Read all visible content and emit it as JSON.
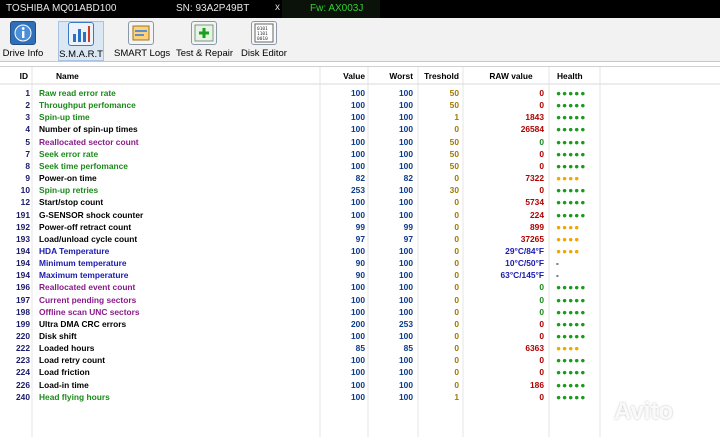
{
  "topbar": {
    "model": "TOSHIBA MQ01ABD100",
    "serial": "SN: 93A2P49BT",
    "close": "x",
    "firmware": "Fw: AX003J"
  },
  "toolbar": [
    {
      "label": "Drive Info",
      "icon": "info-icon",
      "active": false
    },
    {
      "label": "S.M.A.R.T",
      "icon": "smart-chart-icon",
      "active": true
    },
    {
      "label": "SMART Logs",
      "icon": "logs-icon",
      "active": false
    },
    {
      "label": "Test & Repair",
      "icon": "repair-icon",
      "active": false
    },
    {
      "label": "Disk Editor",
      "icon": "hex-editor-icon",
      "active": false
    }
  ],
  "columns": {
    "id": "ID",
    "name": "Name",
    "value": "Value",
    "worst": "Worst",
    "threshold": "Treshold",
    "raw": "RAW value",
    "health": "Health"
  },
  "colors": {
    "green": "#1a8a1a",
    "black": "#000000",
    "purple": "#8a1a8a",
    "blue": "#1a1ab0",
    "value_blue": "#0a3a8a",
    "raw_red": "#b00000",
    "raw_green": "#1a8a1a",
    "raw_blue": "#1a1ab0",
    "health_green": "#1a9a1a",
    "health_yellow": "#f0a800"
  },
  "rows": [
    {
      "id": "1",
      "name": "Raw read error rate",
      "color": "green",
      "value": "100",
      "worst": "100",
      "threshold": "50",
      "raw": "0",
      "raw_color": "raw_red",
      "health": "●●●●●",
      "health_color": "health_green"
    },
    {
      "id": "2",
      "name": "Throughput perfomance",
      "color": "green",
      "value": "100",
      "worst": "100",
      "threshold": "50",
      "raw": "0",
      "raw_color": "raw_red",
      "health": "●●●●●",
      "health_color": "health_green"
    },
    {
      "id": "3",
      "name": "Spin-up time",
      "color": "green",
      "value": "100",
      "worst": "100",
      "threshold": "1",
      "raw": "1843",
      "raw_color": "raw_red",
      "health": "●●●●●",
      "health_color": "health_green"
    },
    {
      "id": "4",
      "name": "Number of spin-up times",
      "color": "black",
      "value": "100",
      "worst": "100",
      "threshold": "0",
      "raw": "26584",
      "raw_color": "raw_red",
      "health": "●●●●●",
      "health_color": "health_green"
    },
    {
      "id": "5",
      "name": "Reallocated sector count",
      "color": "purple",
      "value": "100",
      "worst": "100",
      "threshold": "50",
      "raw": "0",
      "raw_color": "raw_green",
      "health": "●●●●●",
      "health_color": "health_green"
    },
    {
      "id": "7",
      "name": "Seek error rate",
      "color": "green",
      "value": "100",
      "worst": "100",
      "threshold": "50",
      "raw": "0",
      "raw_color": "raw_red",
      "health": "●●●●●",
      "health_color": "health_green"
    },
    {
      "id": "8",
      "name": "Seek time perfomance",
      "color": "green",
      "value": "100",
      "worst": "100",
      "threshold": "50",
      "raw": "0",
      "raw_color": "raw_red",
      "health": "●●●●●",
      "health_color": "health_green"
    },
    {
      "id": "9",
      "name": "Power-on time",
      "color": "black",
      "value": "82",
      "worst": "82",
      "threshold": "0",
      "raw": "7322",
      "raw_color": "raw_red",
      "health": "●●●●",
      "health_color": "health_yellow"
    },
    {
      "id": "10",
      "name": "Spin-up retries",
      "color": "green",
      "value": "253",
      "worst": "100",
      "threshold": "30",
      "raw": "0",
      "raw_color": "raw_red",
      "health": "●●●●●",
      "health_color": "health_green"
    },
    {
      "id": "12",
      "name": "Start/stop count",
      "color": "black",
      "value": "100",
      "worst": "100",
      "threshold": "0",
      "raw": "5734",
      "raw_color": "raw_red",
      "health": "●●●●●",
      "health_color": "health_green"
    },
    {
      "id": "191",
      "name": "G-SENSOR shock counter",
      "color": "black",
      "value": "100",
      "worst": "100",
      "threshold": "0",
      "raw": "224",
      "raw_color": "raw_red",
      "health": "●●●●●",
      "health_color": "health_green"
    },
    {
      "id": "192",
      "name": "Power-off retract count",
      "color": "black",
      "value": "99",
      "worst": "99",
      "threshold": "0",
      "raw": "899",
      "raw_color": "raw_red",
      "health": "●●●●",
      "health_color": "health_yellow"
    },
    {
      "id": "193",
      "name": "Load/unload cycle count",
      "color": "black",
      "value": "97",
      "worst": "97",
      "threshold": "0",
      "raw": "37265",
      "raw_color": "raw_red",
      "health": "●●●●",
      "health_color": "health_yellow"
    },
    {
      "id": "194",
      "name": "HDA Temperature",
      "color": "blue",
      "value": "100",
      "worst": "100",
      "threshold": "0",
      "raw": "29°C/84°F",
      "raw_color": "raw_blue",
      "health": "●●●●",
      "health_color": "health_yellow"
    },
    {
      "id": "194",
      "name": "Minimum temperature",
      "color": "blue",
      "value": "90",
      "worst": "100",
      "threshold": "0",
      "raw": "10°C/50°F",
      "raw_color": "raw_blue",
      "health": "-",
      "health_color": "black"
    },
    {
      "id": "194",
      "name": "Maximum temperature",
      "color": "blue",
      "value": "90",
      "worst": "100",
      "threshold": "0",
      "raw": "63°C/145°F",
      "raw_color": "raw_blue",
      "health": "-",
      "health_color": "black"
    },
    {
      "id": "196",
      "name": "Reallocated event count",
      "color": "purple",
      "value": "100",
      "worst": "100",
      "threshold": "0",
      "raw": "0",
      "raw_color": "raw_green",
      "health": "●●●●●",
      "health_color": "health_green"
    },
    {
      "id": "197",
      "name": "Current pending sectors",
      "color": "purple",
      "value": "100",
      "worst": "100",
      "threshold": "0",
      "raw": "0",
      "raw_color": "raw_green",
      "health": "●●●●●",
      "health_color": "health_green"
    },
    {
      "id": "198",
      "name": "Offline scan UNC sectors",
      "color": "purple",
      "value": "100",
      "worst": "100",
      "threshold": "0",
      "raw": "0",
      "raw_color": "raw_green",
      "health": "●●●●●",
      "health_color": "health_green"
    },
    {
      "id": "199",
      "name": "Ultra DMA CRC errors",
      "color": "black",
      "value": "200",
      "worst": "253",
      "threshold": "0",
      "raw": "0",
      "raw_color": "raw_red",
      "health": "●●●●●",
      "health_color": "health_green"
    },
    {
      "id": "220",
      "name": "Disk shift",
      "color": "black",
      "value": "100",
      "worst": "100",
      "threshold": "0",
      "raw": "0",
      "raw_color": "raw_red",
      "health": "●●●●●",
      "health_color": "health_green"
    },
    {
      "id": "222",
      "name": "Loaded hours",
      "color": "black",
      "value": "85",
      "worst": "85",
      "threshold": "0",
      "raw": "6363",
      "raw_color": "raw_red",
      "health": "●●●●",
      "health_color": "health_yellow"
    },
    {
      "id": "223",
      "name": "Load retry count",
      "color": "black",
      "value": "100",
      "worst": "100",
      "threshold": "0",
      "raw": "0",
      "raw_color": "raw_red",
      "health": "●●●●●",
      "health_color": "health_green"
    },
    {
      "id": "224",
      "name": "Load friction",
      "color": "black",
      "value": "100",
      "worst": "100",
      "threshold": "0",
      "raw": "0",
      "raw_color": "raw_red",
      "health": "●●●●●",
      "health_color": "health_green"
    },
    {
      "id": "226",
      "name": "Load-in time",
      "color": "black",
      "value": "100",
      "worst": "100",
      "threshold": "0",
      "raw": "186",
      "raw_color": "raw_red",
      "health": "●●●●●",
      "health_color": "health_green"
    },
    {
      "id": "240",
      "name": "Head flying hours",
      "color": "green",
      "value": "100",
      "worst": "100",
      "threshold": "1",
      "raw": "0",
      "raw_color": "raw_red",
      "health": "●●●●●",
      "health_color": "health_green"
    }
  ],
  "watermark": "Avito"
}
